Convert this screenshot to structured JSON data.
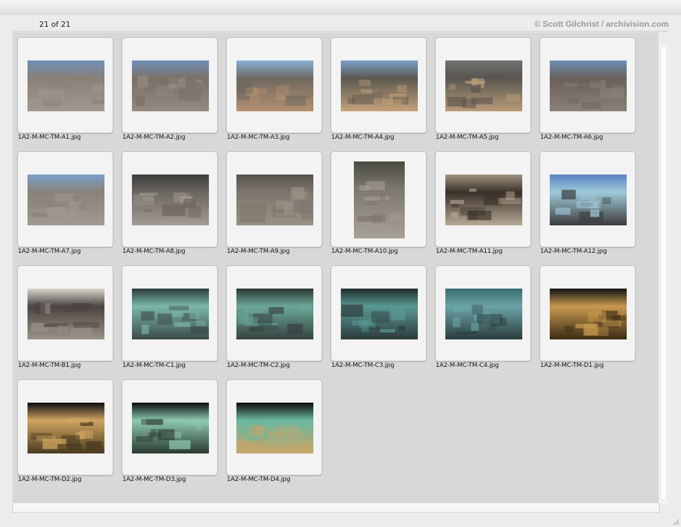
{
  "header": {
    "counter": "21 of 21",
    "credit": "© Scott Gilchrist / archivision.com"
  },
  "thumbnails": [
    {
      "file": "1A2-M-MC-TM-A1.jpg",
      "orientation": "landscape",
      "palette": [
        "#6f8fb8",
        "#8a8078",
        "#a09890"
      ]
    },
    {
      "file": "1A2-M-MC-TM-A2.jpg",
      "orientation": "landscape",
      "palette": [
        "#6f8fb8",
        "#7a7068",
        "#948a80"
      ]
    },
    {
      "file": "1A2-M-MC-TM-A3.jpg",
      "orientation": "landscape",
      "palette": [
        "#8ab0d8",
        "#6e6860",
        "#b49070"
      ]
    },
    {
      "file": "1A2-M-MC-TM-A4.jpg",
      "orientation": "landscape",
      "palette": [
        "#7aa0c8",
        "#5c5850",
        "#c4a27a"
      ]
    },
    {
      "file": "1A2-M-MC-TM-A5.jpg",
      "orientation": "landscape",
      "palette": [
        "#707070",
        "#5a5550",
        "#b89c78"
      ]
    },
    {
      "file": "1A2-M-MC-TM-A6.jpg",
      "orientation": "landscape",
      "palette": [
        "#6f8fb8",
        "#6a625a",
        "#8a8278"
      ]
    },
    {
      "file": "1A2-M-MC-TM-A7.jpg",
      "orientation": "landscape",
      "palette": [
        "#7aa0c8",
        "#8a8278",
        "#a09a90"
      ]
    },
    {
      "file": "1A2-M-MC-TM-A8.jpg",
      "orientation": "landscape",
      "palette": [
        "#3c3c3c",
        "#6a6660",
        "#a49c94"
      ]
    },
    {
      "file": "1A2-M-MC-TM-A9.jpg",
      "orientation": "landscape",
      "palette": [
        "#55524c",
        "#7e766c",
        "#9a9086"
      ]
    },
    {
      "file": "1A2-M-MC-TM-A10.jpg",
      "orientation": "portrait",
      "palette": [
        "#4a4a40",
        "#7c786e",
        "#a8a096"
      ]
    },
    {
      "file": "1A2-M-MC-TM-A11.jpg",
      "orientation": "landscape",
      "palette": [
        "#a09282",
        "#3a3028",
        "#b8aa96"
      ]
    },
    {
      "file": "1A2-M-MC-TM-A12.jpg",
      "orientation": "landscape",
      "palette": [
        "#5a84c4",
        "#9ec8d8",
        "#3c3c3c"
      ]
    },
    {
      "file": "1A2-M-MC-TM-B1.jpg",
      "orientation": "landscape",
      "palette": [
        "#d8d4cc",
        "#4a4440",
        "#9a9288"
      ]
    },
    {
      "file": "1A2-M-MC-TM-C1.jpg",
      "orientation": "landscape",
      "palette": [
        "#2a3a38",
        "#7ab8a8",
        "#3c4a48"
      ]
    },
    {
      "file": "1A2-M-MC-TM-C2.jpg",
      "orientation": "landscape",
      "palette": [
        "#2a3634",
        "#6aa898",
        "#364240"
      ]
    },
    {
      "file": "1A2-M-MC-TM-C3.jpg",
      "orientation": "landscape",
      "palette": [
        "#1e2a2a",
        "#5a9894",
        "#2c3a3a"
      ]
    },
    {
      "file": "1A2-M-MC-TM-C4.jpg",
      "orientation": "landscape",
      "palette": [
        "#3a6e70",
        "#6aa4a6",
        "#2c3c3e"
      ]
    },
    {
      "file": "1A2-M-MC-TM-D1.jpg",
      "orientation": "landscape",
      "palette": [
        "#101010",
        "#c89a50",
        "#3a2a14"
      ]
    },
    {
      "file": "1A2-M-MC-TM-D2.jpg",
      "orientation": "landscape",
      "palette": [
        "#0c0c10",
        "#d0a460",
        "#4a3a20"
      ]
    },
    {
      "file": "1A2-M-MC-TM-D3.jpg",
      "orientation": "landscape",
      "palette": [
        "#0a0c10",
        "#8ec8b0",
        "#2a3a30"
      ]
    },
    {
      "file": "1A2-M-MC-TM-D4.jpg",
      "orientation": "landscape",
      "palette": [
        "#0e0a0a",
        "#6ab8a0",
        "#c8a468"
      ]
    }
  ]
}
